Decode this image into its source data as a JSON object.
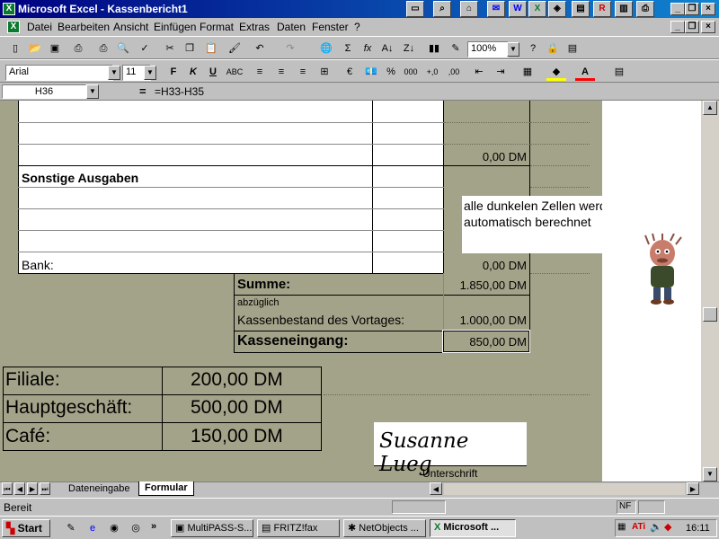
{
  "window": {
    "title": "Microsoft Excel - Kassenbericht1",
    "app_icon": "X"
  },
  "quick_icons": [
    "folder-icon",
    "search-icon",
    "home-icon",
    "mail-icon",
    "word-icon",
    "excel-icon",
    "explorer-icon",
    "doc-icon",
    "red-r-icon",
    "notepad-icon",
    "printer-icon"
  ],
  "menu": {
    "items": [
      "Datei",
      "Bearbeiten",
      "Ansicht",
      "Einfügen",
      "Format",
      "Extras",
      "Daten",
      "Fenster",
      "?"
    ]
  },
  "toolbar": {
    "zoom": "100%"
  },
  "format": {
    "font": "Arial",
    "size": "11"
  },
  "formula": {
    "cell_ref": "H36",
    "equals": "=",
    "content": "=H33-H35"
  },
  "sheet": {
    "zero_value": "0,00 DM",
    "sonstige_header": "Sonstige Ausgaben",
    "bank_label": "Bank:",
    "bank_value": "0,00 DM",
    "summe_label": "Summe:",
    "summe_value": "1.850,00 DM",
    "abzueglich": "abzüglich",
    "kassenbestand_label": "Kassenbestand des Vortages:",
    "kassenbestand_value": "1.000,00 DM",
    "kasseneingang_label": "Kasseneingang:",
    "kasseneingang_value": "850,00 DM",
    "note_line1": "alle dunkelen Zellen werden",
    "note_line2": "automatisch berechnet",
    "branches": [
      {
        "label": "Filiale:",
        "value": "200,00 DM"
      },
      {
        "label": "Hauptgeschäft:",
        "value": "500,00 DM"
      },
      {
        "label": "Café:",
        "value": "150,00 DM"
      }
    ],
    "signature": "Susanne Lueg",
    "signature_label": "Unterschrift"
  },
  "tabs": [
    "Dateneingabe",
    "Formular"
  ],
  "status": {
    "text": "Bereit",
    "nf": "NF"
  },
  "taskbar": {
    "start": "Start",
    "tasks": [
      "MultiPASS-S...",
      "FRITZ!fax",
      "NetObjects ...",
      "Microsoft ..."
    ],
    "time": "16:11"
  }
}
